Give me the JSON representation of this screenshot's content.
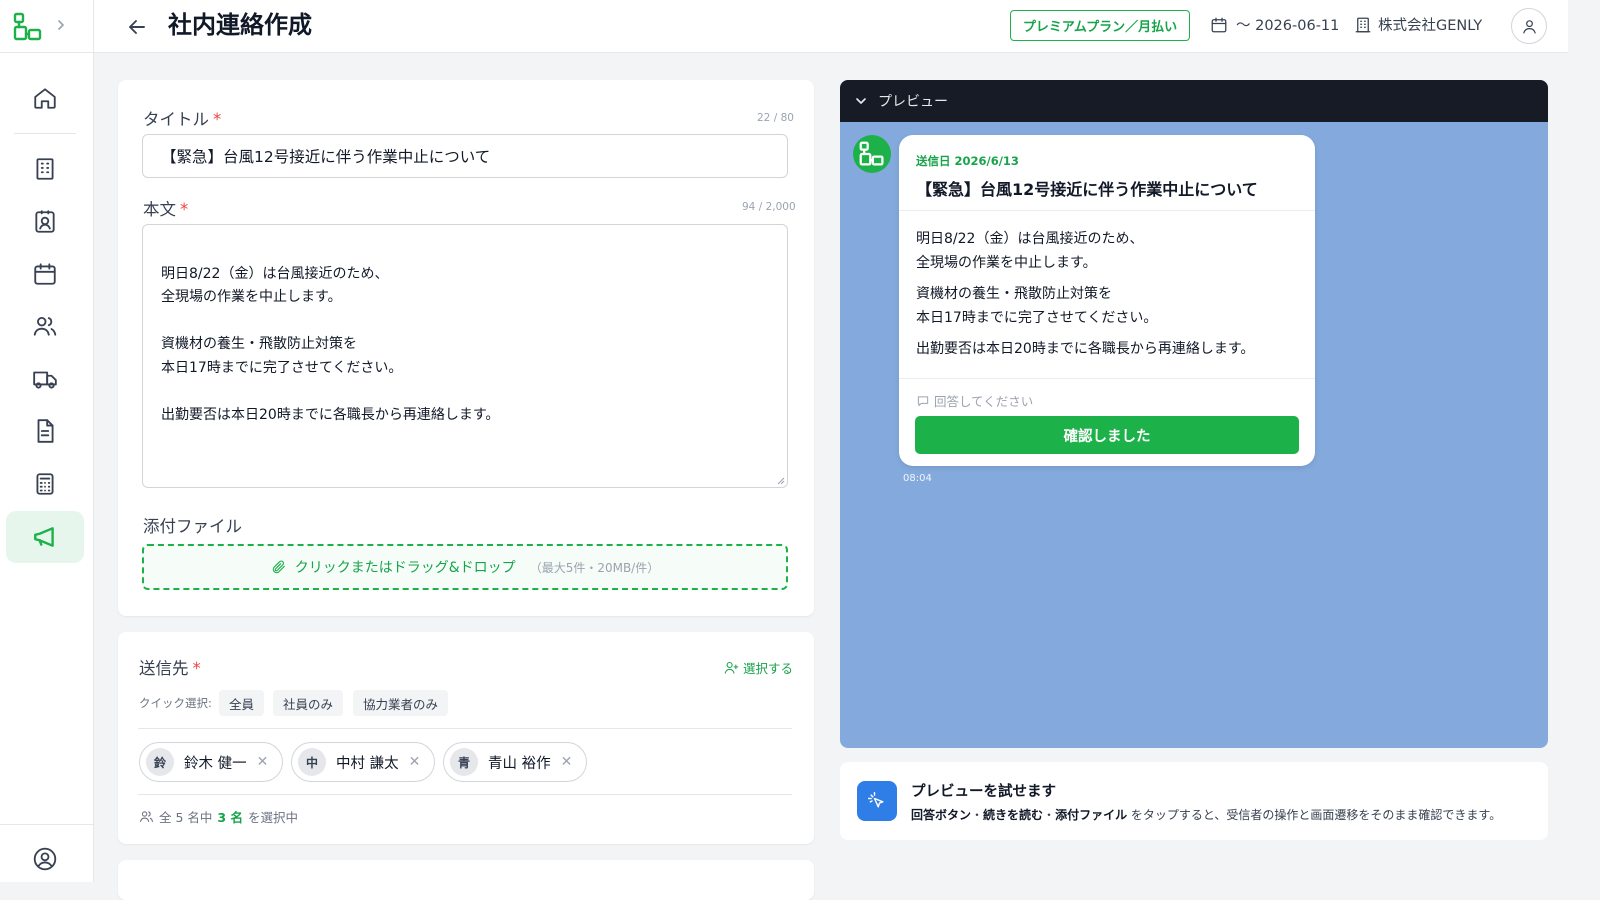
{
  "header": {
    "title": "社内連絡作成",
    "plan_label": "プレミアムプラン／月払い",
    "date_label": "〜 2026-06-11",
    "company": "株式会社GENLY"
  },
  "form": {
    "title_label": "タイトル",
    "title_counter": "22 / 80",
    "title_value": "【緊急】台風12号接近に伴う作業中止について",
    "body_label": "本文",
    "body_counter": "94 / 2,000",
    "body_value": "明日8/22（金）は台風接近のため、\n全現場の作業を中止します。\n\n資機材の養生・飛散防止対策を\n本日17時までに完了させてください。\n\n出勤要否は本日20時までに各職長から再連絡します。",
    "attach_label": "添付ファイル",
    "attach_main": "クリックまたはドラッグ&ドロップ",
    "attach_sub": "（最大5件・20MB/件）"
  },
  "recipients": {
    "label": "送信先",
    "select_link": "選択する",
    "quick_label": "クイック選択:",
    "quick": [
      "全員",
      "社員のみ",
      "協力業者のみ"
    ],
    "chips": [
      {
        "initial": "鈴",
        "name": "鈴木 健一"
      },
      {
        "initial": "中",
        "name": "中村 謙太"
      },
      {
        "initial": "青",
        "name": "青山 裕作"
      }
    ],
    "count_prefix": "全 5 名中",
    "count_value": "3 名",
    "count_suffix": "を選択中"
  },
  "preview": {
    "header_label": "プレビュー",
    "sent_date": "送信日 2026/6/13",
    "title": "【緊急】台風12号接近に伴う作業中止について",
    "para1": "明日8/22（金）は台風接近のため、\n全現場の作業を中止します。",
    "para2": "資機材の養生・飛散防止対策を\n本日17時までに完了させてください。",
    "para3": "出勤要否は本日20時までに各職長から再連絡します。",
    "reply_hint": "回答してください",
    "confirm_button": "確認しました",
    "time": "08:04"
  },
  "tip": {
    "title": "プレビューを試せます",
    "k1": "回答ボタン",
    "sep": "・",
    "k2": "続きを読む",
    "k3": "添付ファイル",
    "text_suffix": "をタップすると、受信者の操作と画面遷移をそのまま確認できます。"
  },
  "colors": {
    "brand": "#1db14a",
    "preview_bg": "#84aadd",
    "preview_header": "#171b26",
    "required": "#ef4444"
  }
}
